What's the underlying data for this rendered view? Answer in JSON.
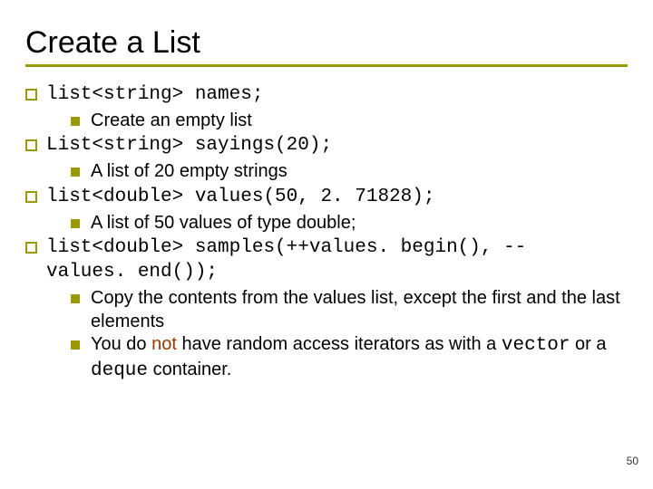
{
  "title": "Create a List",
  "items": [
    {
      "level": 0,
      "kind": "code",
      "text": "list<string> names;"
    },
    {
      "level": 1,
      "kind": "text",
      "text": "Create an empty list"
    },
    {
      "level": 0,
      "kind": "code",
      "text": "List<string> sayings(20);"
    },
    {
      "level": 1,
      "kind": "text",
      "text": "A list of 20 empty strings"
    },
    {
      "level": 0,
      "kind": "code",
      "text": "list<double> values(50, 2. 71828);"
    },
    {
      "level": 1,
      "kind": "text",
      "text": "A list of 50 values of type double;"
    },
    {
      "level": 0,
      "kind": "codewrap",
      "line1": "list<double> samples(++values. begin(), --",
      "line2": "values. end());"
    },
    {
      "level": 1,
      "kind": "text",
      "text": "Copy the contents from the values list, except the first and the last elements"
    },
    {
      "level": 1,
      "kind": "richtext",
      "pre": "You do ",
      "not": "not",
      "mid": " have random access iterators as with a ",
      "code1": "vector",
      "mid2": " or a ",
      "code2": "deque",
      "post": " container."
    }
  ],
  "page_number": "50"
}
